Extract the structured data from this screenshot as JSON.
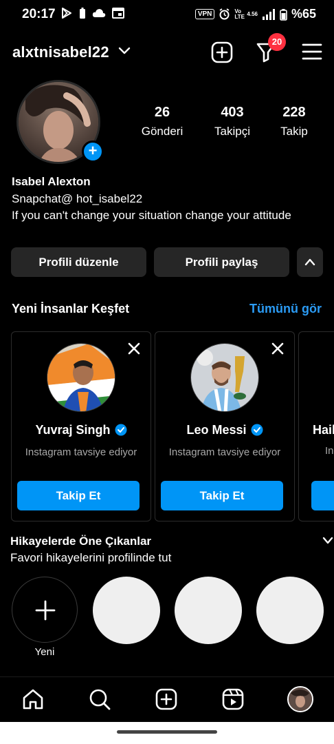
{
  "status_bar": {
    "time": "20:17",
    "battery": "%65",
    "vpn": "VPN",
    "volte": "Vo LTE",
    "net_speed": "4.56"
  },
  "header": {
    "username": "alxtnisabel22",
    "notification_count": "20"
  },
  "profile": {
    "stats": [
      {
        "value": "26",
        "label": "Gönderi"
      },
      {
        "value": "403",
        "label": "Takipçi"
      },
      {
        "value": "228",
        "label": "Takip"
      }
    ],
    "name": "Isabel Alexton",
    "bio_line1": "Snapchat@ hot_isabel22",
    "bio_line2": "If you can't change your situation change your attitude"
  },
  "actions": {
    "edit_label": "Profili düzenle",
    "share_label": "Profili paylaş"
  },
  "discover": {
    "title": "Yeni İnsanlar Keşfet",
    "see_all": "Tümünü gör",
    "cards": [
      {
        "name": "Yuvraj Singh",
        "subtitle": "Instagram tavsiye ediyor",
        "button": "Takip Et",
        "verified": true
      },
      {
        "name": "Leo Messi",
        "subtitle": "Instagram tavsiye ediyor",
        "button": "Takip Et",
        "verified": true
      },
      {
        "name": "Hail",
        "subtitle": "In",
        "button": "",
        "verified": false
      }
    ]
  },
  "highlights": {
    "title": "Hikayelerde Öne Çıkanlar",
    "subtitle": "Favori hikayelerini profilinde tut",
    "new_label": "Yeni"
  },
  "colors": {
    "accent": "#0095f6",
    "link": "#2b9bf4",
    "badge": "#ff3040",
    "button_bg": "#262626"
  },
  "icons": [
    "home-icon",
    "search-icon",
    "create-icon",
    "reels-icon",
    "profile-avatar-icon"
  ]
}
